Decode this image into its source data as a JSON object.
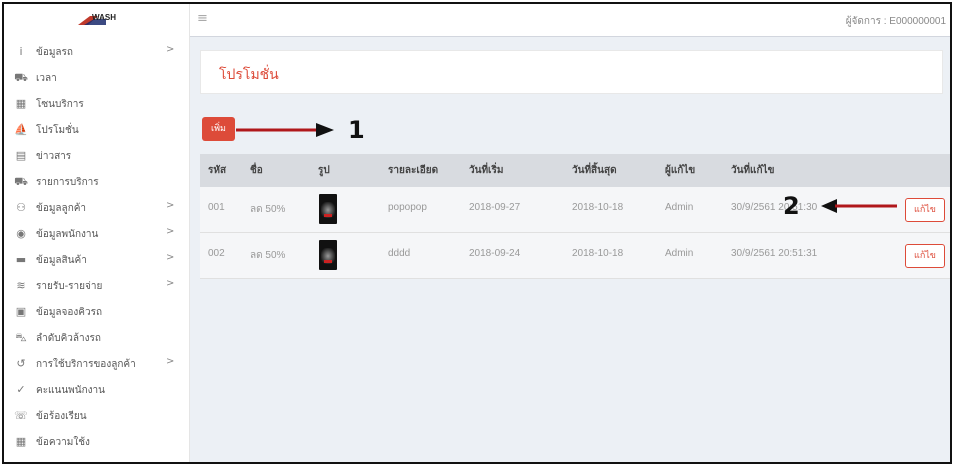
{
  "header": {
    "logo_text": "WASH",
    "manager_label": "ผู้จัดการ : E000000001"
  },
  "sidebar": {
    "items": [
      {
        "label": "ข้อมูลรถ",
        "icon": "info-icon",
        "chevron": ">"
      },
      {
        "label": "เวลา",
        "icon": "car-icon",
        "chevron": ""
      },
      {
        "label": "โซนบริการ",
        "icon": "grid-icon",
        "chevron": ""
      },
      {
        "label": "โปรโมชั่น",
        "icon": "promo-icon",
        "chevron": ""
      },
      {
        "label": "ข่าวสาร",
        "icon": "news-icon",
        "chevron": ""
      },
      {
        "label": "รายการบริการ",
        "icon": "car-icon",
        "chevron": ""
      },
      {
        "label": "ข้อมูลลูกค้า",
        "icon": "users-icon",
        "chevron": ">"
      },
      {
        "label": "ข้อมูลพนักงาน",
        "icon": "user-circle-icon",
        "chevron": ">"
      },
      {
        "label": "ข้อมูลสินค้า",
        "icon": "box-icon",
        "chevron": ">"
      },
      {
        "label": "รายรับ-รายจ่าย",
        "icon": "money-icon",
        "chevron": ">"
      },
      {
        "label": "ข้อมูลจองคิวรถ",
        "icon": "calendar-icon",
        "chevron": ""
      },
      {
        "label": "ลำดับคิวล้างรถ",
        "icon": "car-side-icon",
        "chevron": ""
      },
      {
        "label": "การใช้บริการของลูกค้า",
        "icon": "history-icon",
        "chevron": ">"
      },
      {
        "label": "คะแนนพนักงาน",
        "icon": "thumbs-up-icon",
        "chevron": ""
      },
      {
        "label": "ข้อร้องเรียน",
        "icon": "complaint-icon",
        "chevron": ""
      },
      {
        "label": "ข้อความใช้ง",
        "icon": "table-icon",
        "chevron": ""
      }
    ]
  },
  "main": {
    "page_title": "โปรโมชั่น",
    "add_button": "เพิ่ม",
    "annotation_1": "1",
    "annotation_2": "2",
    "table": {
      "columns": [
        "รหัส",
        "ชื่อ",
        "รูป",
        "รายละเอียด",
        "วันที่เริ่ม",
        "วันที่สิ้นสุด",
        "ผู้แก้ไข",
        "วันที่แก้ไข"
      ],
      "rows": [
        {
          "id": "001",
          "name": "ลด 50%",
          "detail": "popopop",
          "start": "2018-09-27",
          "end": "2018-10-18",
          "editor": "Admin",
          "edited": "30/9/2561 20:51:30",
          "edit_label": "แก้ไข"
        },
        {
          "id": "002",
          "name": "ลด 50%",
          "detail": "dddd",
          "start": "2018-09-24",
          "end": "2018-10-18",
          "editor": "Admin",
          "edited": "30/9/2561 20:51:31",
          "edit_label": "แก้ไข"
        }
      ]
    }
  },
  "colors": {
    "accent": "#dd4b39",
    "annotation_arrow": "#b0171b"
  }
}
